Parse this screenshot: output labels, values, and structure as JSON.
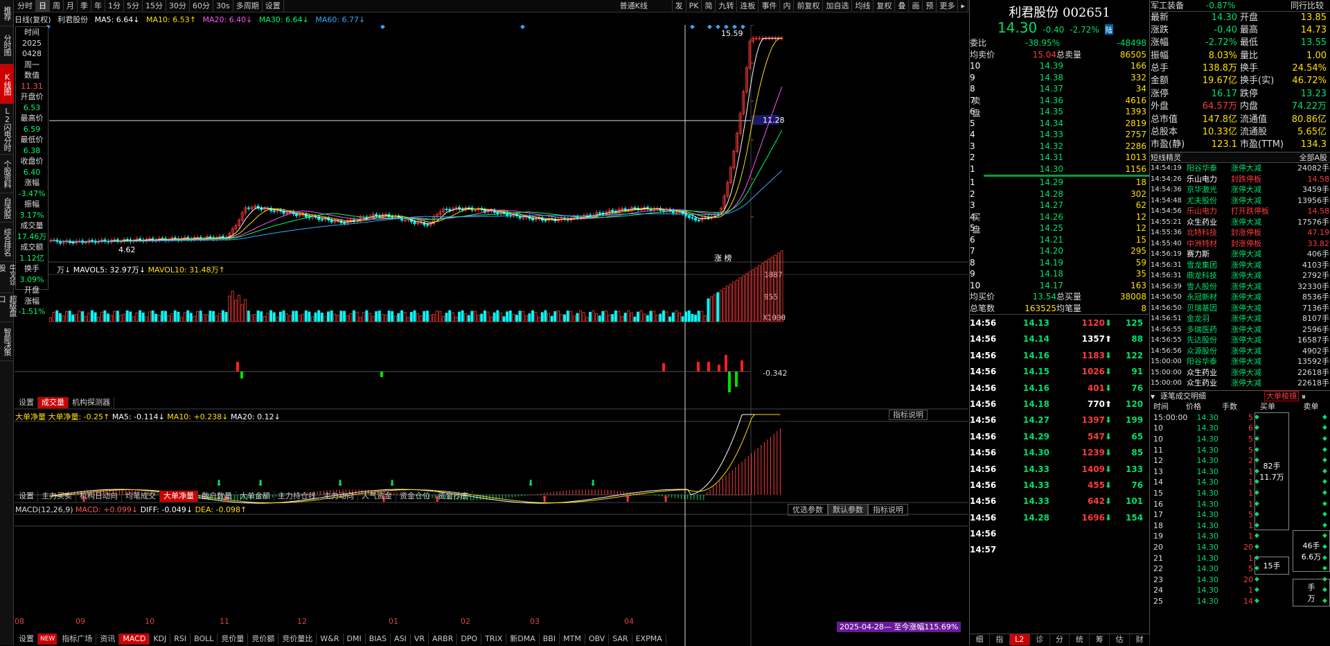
{
  "app": {
    "colors": {
      "up": "#ff3b3b",
      "down": "#00ffff",
      "green": "#00e06a",
      "ma5": "#ffffff",
      "ma10": "#ffe000",
      "ma20": "#ff55ff",
      "ma30": "#00ff66",
      "ma60": "#33aaff"
    }
  },
  "left_tabs": [
    {
      "label": "推荐",
      "active": false
    },
    {
      "label": "分时图",
      "active": false
    },
    {
      "label": "K线图",
      "active": true
    },
    {
      "label": "L2闪电分时",
      "active": false
    },
    {
      "label": "个股资料",
      "active": false
    },
    {
      "label": "自选股",
      "active": false
    },
    {
      "label": "综合排名",
      "active": false
    },
    {
      "label": "牛叉诊股",
      "active": false
    },
    {
      "label": "超级盘口",
      "active": false
    },
    {
      "label": "智能决策",
      "active": false
    }
  ],
  "toolbar": {
    "periods": [
      "分时",
      "日",
      "周",
      "月",
      "季",
      "年",
      "1分",
      "5分",
      "15分",
      "30分",
      "60分",
      "30s"
    ],
    "active_period": "日",
    "multi": "多周期",
    "settings": "设置",
    "kline_type": "普通K线",
    "right_buttons": [
      "发",
      "PK",
      "简",
      "九转",
      "连板",
      "事件",
      "内",
      "前复权",
      "加自选",
      "均线",
      "复权",
      "叠",
      "画",
      "预",
      "更多"
    ]
  },
  "info_line": {
    "name": "日线(复权)",
    "stock": "利君股份",
    "ma5": "MA5: 6.64↓",
    "ma10": "MA10: 6.53↑",
    "ma20": "MA20: 6.40↓",
    "ma30": "MA30: 6.64↓",
    "ma60": "MA60: 6.77↓"
  },
  "price_axis": [
    "16.20",
    "14.19",
    "12.15",
    "10.13",
    "8.09",
    "6.05"
  ],
  "cursor_price": "11.28",
  "high_label": "15.59",
  "low_label": "4.62",
  "zb_label": "涨 榜",
  "date_axis": [
    "08",
    "09",
    "10",
    "11",
    "12",
    "01",
    "02",
    "03",
    "04"
  ],
  "data_window": [
    {
      "k": "时间",
      "v": "2025",
      "c": "k"
    },
    {
      "k": "",
      "v": "0428",
      "c": "k"
    },
    {
      "k": "",
      "v": "周一",
      "c": "k"
    },
    {
      "k": "数值",
      "v": "11.31",
      "c": "v"
    },
    {
      "k": "开盘价",
      "v": "6.53",
      "c": "g"
    },
    {
      "k": "最高价",
      "v": "6.59",
      "c": "g"
    },
    {
      "k": "最低价",
      "v": "6.38",
      "c": "g"
    },
    {
      "k": "收盘价",
      "v": "6.40",
      "c": "g"
    },
    {
      "k": "涨幅",
      "v": "-3.47%",
      "c": "g"
    },
    {
      "k": "振幅",
      "v": "3.17%",
      "c": "g"
    },
    {
      "k": "成交量",
      "v": "17.46万",
      "c": "g"
    },
    {
      "k": "成交额",
      "v": "1.12亿",
      "c": "g"
    },
    {
      "k": "换手",
      "v": "3.09%",
      "c": "g"
    },
    {
      "k": "开盘",
      "v": "",
      "c": "k"
    },
    {
      "k": "涨幅",
      "v": "-1.51%",
      "c": "g"
    }
  ],
  "vol_line": {
    "vol": "万↓",
    "mavol5": "MAVOL5: 32.97万↓",
    "mavol10": "MAVOL10: 31.48万↑",
    "axis_top": "1887",
    "axis_mid": "955",
    "unit": "X1000"
  },
  "vol_tabs": [
    "设置",
    "成交量",
    "机构探测器"
  ],
  "vol_tab_active": "成交量",
  "bigorder_line": {
    "name": "大单净量",
    "value": "大单净量: -0.25↑",
    "ma5": "MA5: -0.114↓",
    "ma10": "MA10: +0.238↓",
    "ma20": "MA20: 0.12↓",
    "button": "指标说明",
    "axis_top": "+4.94",
    "axis_mid": "-0.342"
  },
  "fund_tabs": [
    "设置",
    "主力买卖",
    "机构日动向",
    "均笔成交",
    "大单净量",
    "散户数量",
    "大单金额",
    "主力持仓线",
    "主力动向",
    "人气资金",
    "资金仓位",
    "资金抄底"
  ],
  "fund_tab_active": "大单净量",
  "macd_line": {
    "name": "MACD(12,26,9)",
    "macd": "MACD: +0.099↓",
    "diff": "DIFF: -0.049↓",
    "dea": "DEA: -0.098↑",
    "btn1": "优选参数",
    "btn2": "默认参数",
    "btn3": "指标说明",
    "axis": [
      "+2.09",
      "+1.84",
      "+1.24",
      "+0.629",
      "0"
    ],
    "footer_note": "2025-04-28— 至今涨幅115.69%"
  },
  "bottom_tabs": [
    "设置",
    "NEW",
    "指标广场",
    "资讯",
    "MACD",
    "KDJ",
    "RSI",
    "BOLL",
    "竞价量",
    "竞价额",
    "竞价量比",
    "W&R",
    "DMI",
    "BIAS",
    "ASI",
    "VR",
    "ARBR",
    "DPO",
    "TRIX",
    "新DMA",
    "BBI",
    "MTM",
    "OBV",
    "SAR",
    "EXPMA"
  ],
  "bottom_active": "MACD",
  "quote": {
    "title": "利君股份 002651",
    "price": "14.30",
    "change": "-0.40",
    "pct": "-2.72%",
    "badge": "陆",
    "weibi_label": "委比",
    "weibi": "-38.95%",
    "weicha": "-48498",
    "sell_avg_label": "均卖价",
    "sell_avg": "15.04",
    "sell_total_label": "总卖量",
    "sell_total": "86505",
    "sells": [
      [
        "10",
        "14.39",
        "166"
      ],
      [
        "9",
        "14.38",
        "332"
      ],
      [
        "8",
        "14.37",
        "34"
      ],
      [
        "7",
        "14.36",
        "4616"
      ],
      [
        "6",
        "14.35",
        "1393"
      ],
      [
        "5",
        "14.34",
        "2819"
      ],
      [
        "4",
        "14.33",
        "2757"
      ],
      [
        "3",
        "14.32",
        "2286"
      ],
      [
        "2",
        "14.31",
        "1013"
      ],
      [
        "1",
        "14.30",
        "1156"
      ]
    ],
    "buys": [
      [
        "1",
        "14.29",
        "18"
      ],
      [
        "2",
        "14.28",
        "302"
      ],
      [
        "3",
        "14.27",
        "62"
      ],
      [
        "4",
        "14.26",
        "12"
      ],
      [
        "5",
        "14.25",
        "12"
      ],
      [
        "6",
        "14.21",
        "15"
      ],
      [
        "7",
        "14.20",
        "295"
      ],
      [
        "8",
        "14.19",
        "59"
      ],
      [
        "9",
        "14.18",
        "35"
      ],
      [
        "10",
        "14.17",
        "163"
      ]
    ],
    "sell_side": "卖盘",
    "buy_side": "买盘",
    "buy_avg_label": "均买价",
    "buy_avg": "13.54",
    "buy_total_label": "总买量",
    "buy_total": "38008",
    "bishu_label": "总笔数",
    "bishu": "163525",
    "junbi_label": "均笔量",
    "junbi": "8",
    "ticks": [
      [
        "14:56",
        "14.13",
        "1120",
        "down",
        "125"
      ],
      [
        "14:56",
        "14.14",
        "1357",
        "up",
        "88"
      ],
      [
        "14:56",
        "14.16",
        "1183",
        "down",
        "122"
      ],
      [
        "14:56",
        "14.15",
        "1026",
        "down",
        "91"
      ],
      [
        "14:56",
        "14.16",
        "401",
        "down",
        "76"
      ],
      [
        "14:56",
        "14.18",
        "770",
        "up",
        "120"
      ],
      [
        "14:56",
        "14.27",
        "1397",
        "down",
        "199"
      ],
      [
        "14:56",
        "14.29",
        "547",
        "down",
        "65"
      ],
      [
        "14:56",
        "14.30",
        "1239",
        "down",
        "85"
      ],
      [
        "14:56",
        "14.33",
        "1409",
        "down",
        "133"
      ],
      [
        "14:56",
        "14.33",
        "455",
        "down",
        "76"
      ],
      [
        "14:56",
        "14.33",
        "642",
        "down",
        "101"
      ],
      [
        "14:56",
        "14.28",
        "1696",
        "down",
        "154"
      ],
      [
        "14:56",
        "",
        "",
        "",
        ""
      ],
      [
        "14:57",
        "",
        "",
        "",
        ""
      ]
    ],
    "bottom_tabs": [
      "细",
      "指",
      "L2",
      "诊",
      "分",
      "统",
      "筹",
      "估",
      "财"
    ],
    "bottom_active": "L2"
  },
  "l2": {
    "sector": "军工装备",
    "sector_pct": "-0.87%",
    "compare": "同行比较",
    "stats": [
      [
        "最新",
        "14.30",
        "开盘",
        "13.85"
      ],
      [
        "涨跌",
        "-0.40",
        "最高",
        "14.73"
      ],
      [
        "涨幅",
        "-2.72%",
        "最低",
        "13.55"
      ],
      [
        "振幅",
        "8.03%",
        "量比",
        "1.00"
      ],
      [
        "总手",
        "138.8万",
        "换手",
        "24.54%"
      ],
      [
        "金额",
        "19.67亿",
        "换手(实)",
        "46.72%"
      ],
      [
        "涨停",
        "16.17",
        "跌停",
        "13.23"
      ],
      [
        "外盘",
        "64.57万",
        "内盘",
        "74.22万"
      ],
      [
        "总市值",
        "147.8亿",
        "流通值",
        "80.86亿"
      ],
      [
        "总股本",
        "10.33亿",
        "流通股",
        "5.65亿"
      ],
      [
        "市盈(静)",
        "123.1",
        "市盈(TTM)",
        "134.3"
      ]
    ],
    "elf_title": "短线精灵",
    "elf_scope": "全部A股",
    "elf": [
      [
        "14:54:19",
        "阳谷华泰",
        "涨停大减",
        "24082手",
        "g"
      ],
      [
        "14:54:26",
        "乐山电力",
        "封跌停板",
        "14.58",
        "w"
      ],
      [
        "14:54:36",
        "京华激光",
        "涨停大减",
        "3459手",
        "g"
      ],
      [
        "14:54:48",
        "尤夫股份",
        "涨停大减",
        "13956手",
        "g"
      ],
      [
        "14:54:56",
        "乐山电力",
        "打开跌停板",
        "14.58",
        "r"
      ],
      [
        "14:55:21",
        "众生药业",
        "涨停大减",
        "17576手",
        "w"
      ],
      [
        "14:55:36",
        "北特科技",
        "封涨停板",
        "47.19",
        "r"
      ],
      [
        "14:55:40",
        "中洲特材",
        "封涨停板",
        "33.82",
        "r"
      ],
      [
        "14:56:19",
        "赛力斯",
        "涨停大减",
        "406手",
        "w"
      ],
      [
        "14:56:31",
        "雪龙集团",
        "涨停大减",
        "4103手",
        "g"
      ],
      [
        "14:56:31",
        "鼎龙科技",
        "涨停大减",
        "2792手",
        "g"
      ],
      [
        "14:56:39",
        "雪人股份",
        "涨停大减",
        "32330手",
        "g"
      ],
      [
        "14:56:50",
        "永冠新材",
        "涨停大减",
        "8536手",
        "g"
      ],
      [
        "14:56:50",
        "贝瑞基因",
        "涨停大减",
        "7136手",
        "g"
      ],
      [
        "14:56:51",
        "金龙羽",
        "涨停大减",
        "8107手",
        "g"
      ],
      [
        "14:56:55",
        "多瑞医药",
        "涨停大减",
        "2596手",
        "g"
      ],
      [
        "14:56:55",
        "先达股份",
        "涨停大减",
        "16587手",
        "g"
      ],
      [
        "14:56:56",
        "众源股份",
        "涨停大减",
        "4902手",
        "g"
      ],
      [
        "15:00:00",
        "阳谷华泰",
        "涨停大减",
        "13592手",
        "g"
      ],
      [
        "15:00:00",
        "众生药业",
        "涨停大减",
        "22618手",
        "w"
      ],
      [
        "15:00:00",
        "众生药业",
        "涨停大减",
        "22618手",
        "w"
      ]
    ],
    "trade_title": "逐笔成交明细",
    "big_btn": "大单棱镜",
    "trade_cols": [
      "时间",
      "价格",
      "手数",
      "买单",
      "卖单"
    ],
    "trades": [
      [
        "15:00:00",
        "14.30",
        "5"
      ],
      [
        "10",
        "14.30",
        "6"
      ],
      [
        "10",
        "14.30",
        "5"
      ],
      [
        "11",
        "14.30",
        "5"
      ],
      [
        "12",
        "14.30",
        "2"
      ],
      [
        "13",
        "14.30",
        "1"
      ],
      [
        "14",
        "14.30",
        "1"
      ],
      [
        "15",
        "14.30",
        "1"
      ],
      [
        "16",
        "14.30",
        "1"
      ],
      [
        "17",
        "14.30",
        "5"
      ],
      [
        "18",
        "14.30",
        "1"
      ],
      [
        "19",
        "14.30",
        "1"
      ],
      [
        "20",
        "14.30",
        "20"
      ],
      [
        "21",
        "14.30",
        "1"
      ],
      [
        "22",
        "14.30",
        "5"
      ],
      [
        "23",
        "14.30",
        "20"
      ],
      [
        "24",
        "14.30",
        "1"
      ],
      [
        "25",
        "14.30",
        "14"
      ]
    ],
    "buy_box1": "82手",
    "buy_box1b": "11.7万",
    "sell_box": "46手",
    "sell_box_b": "6.6万",
    "buy_box2": "15手",
    "sell_box2": "手",
    "sell_box2b": "万"
  }
}
